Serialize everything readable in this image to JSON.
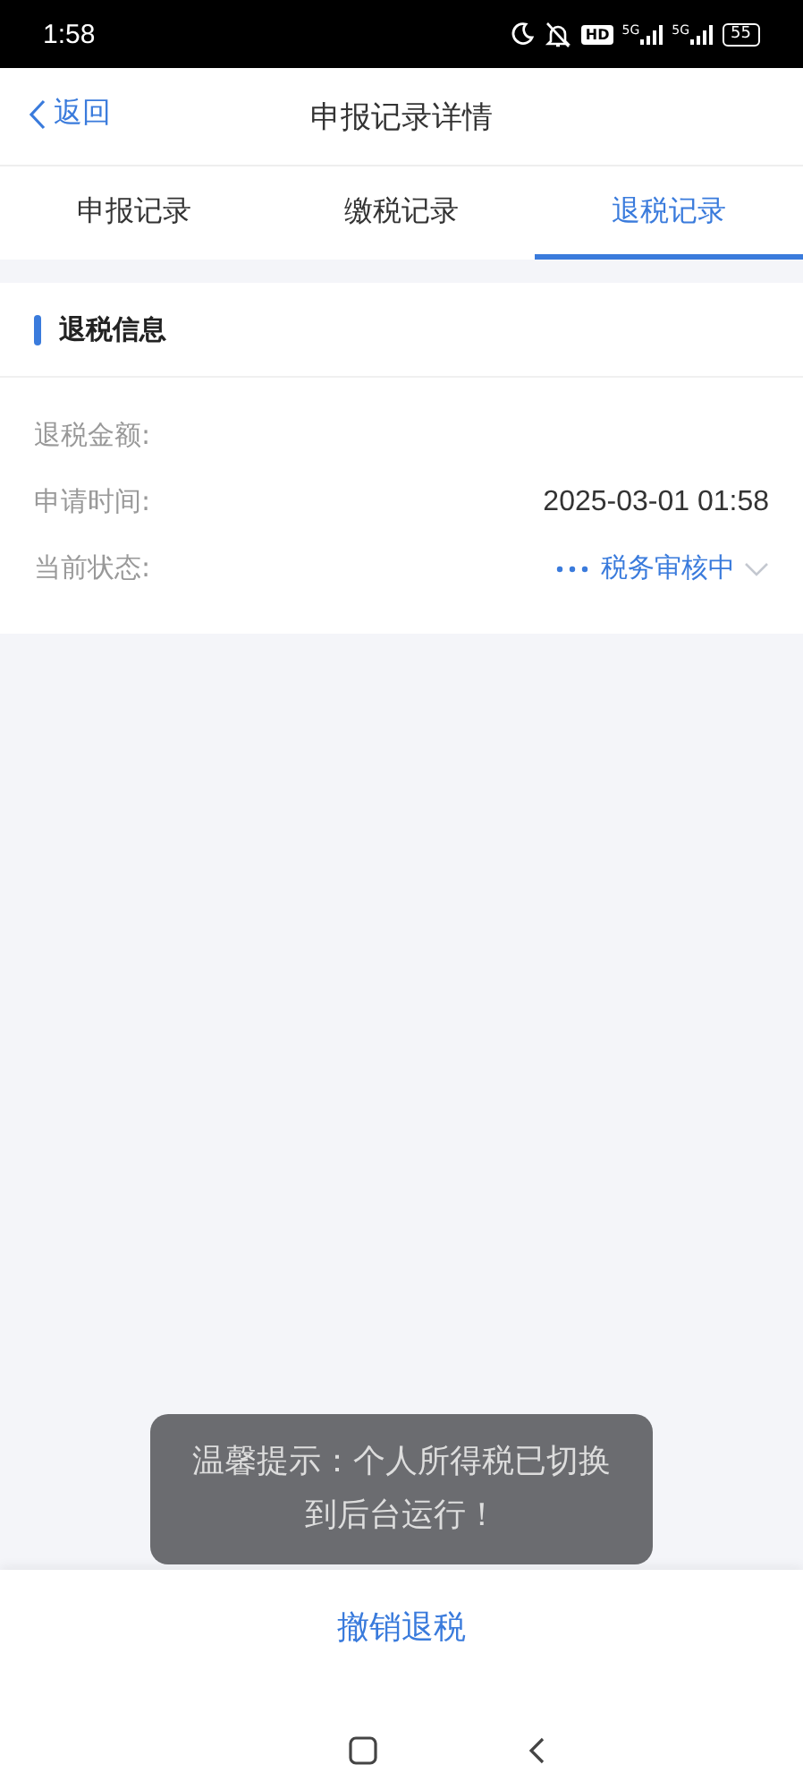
{
  "status_bar": {
    "time": "1:58",
    "hd": "HD",
    "networks": [
      "5G",
      "5G"
    ],
    "battery": "55"
  },
  "header": {
    "back": "返回",
    "title": "申报记录详情"
  },
  "tabs": [
    {
      "label": "申报记录",
      "selected": false
    },
    {
      "label": "缴税记录",
      "selected": false
    },
    {
      "label": "退税记录",
      "selected": true
    }
  ],
  "section": {
    "title": "退税信息"
  },
  "fields": [
    {
      "label": "退税金额:",
      "kind": "blank"
    },
    {
      "label": "申请时间:",
      "value": "2025-03-01 01:58",
      "kind": "text"
    },
    {
      "label": "当前状态:",
      "value": "税务审核中",
      "kind": "status"
    }
  ],
  "toast": "温馨提示：个人所得税已切换到后台运行！",
  "action": "撤销退税"
}
